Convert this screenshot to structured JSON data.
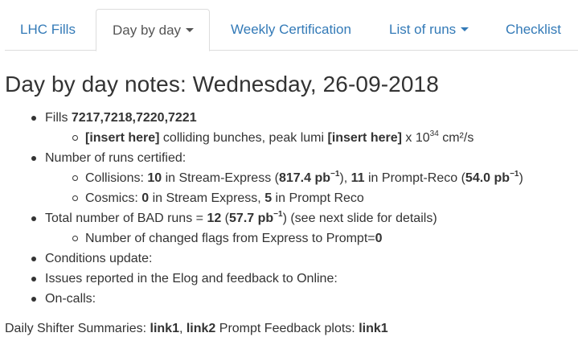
{
  "tabs": {
    "lhc_fills": "LHC Fills",
    "day_by_day": "Day by day",
    "weekly_certification": "Weekly Certification",
    "list_of_runs": "List of runs",
    "checklist": "Checklist"
  },
  "title": "Day by day notes: Wednesday, 26-09-2018",
  "notes": {
    "fills_label": "Fills ",
    "fills_value": "7217,7218,7220,7221",
    "fills_sub": {
      "insert1": "[insert here]",
      "text1": " colliding bunches, peak lumi ",
      "insert2": "[insert here]",
      "text2": " x 10",
      "exp": "34",
      "unit": " cm²/s"
    },
    "runs_certified_label": "Number of runs certified:",
    "collisions": {
      "label": "Collisions: ",
      "express_count": "10",
      "t1": " in Stream-Express (",
      "express_lumi": "817.4 pb",
      "t2": "), ",
      "prompt_count": "11",
      "t3": " in Prompt-Reco (",
      "prompt_lumi": "54.0 pb",
      "t4": ")",
      "exp": "−1"
    },
    "cosmics": {
      "label": "Cosmics: ",
      "express_count": "0",
      "t1": " in Stream Express, ",
      "prompt_count": "5",
      "t2": " in Prompt Reco"
    },
    "bad_runs": {
      "label": "Total number of BAD runs = ",
      "count": "12",
      "t1": " (",
      "lumi": "57.7 pb",
      "exp": "−1",
      "t2": ")",
      "t3": " (see next slide for details)"
    },
    "changed_flags": {
      "label": "Number of changed flags from Express to Prompt=",
      "value": "0"
    },
    "conditions": "Conditions update:",
    "issues": "Issues reported in the Elog and feedback to Online:",
    "oncalls": "On-calls:"
  },
  "footer": {
    "summaries_label": "Daily Shifter Summaries: ",
    "link1": "link1",
    "sep": ", ",
    "link2": "link2",
    "feedback_label": " Prompt Feedback plots: ",
    "plots_link": "link1"
  },
  "colors": {
    "link": "#337ab7",
    "text": "#333333",
    "tab_border": "#dddddd"
  }
}
